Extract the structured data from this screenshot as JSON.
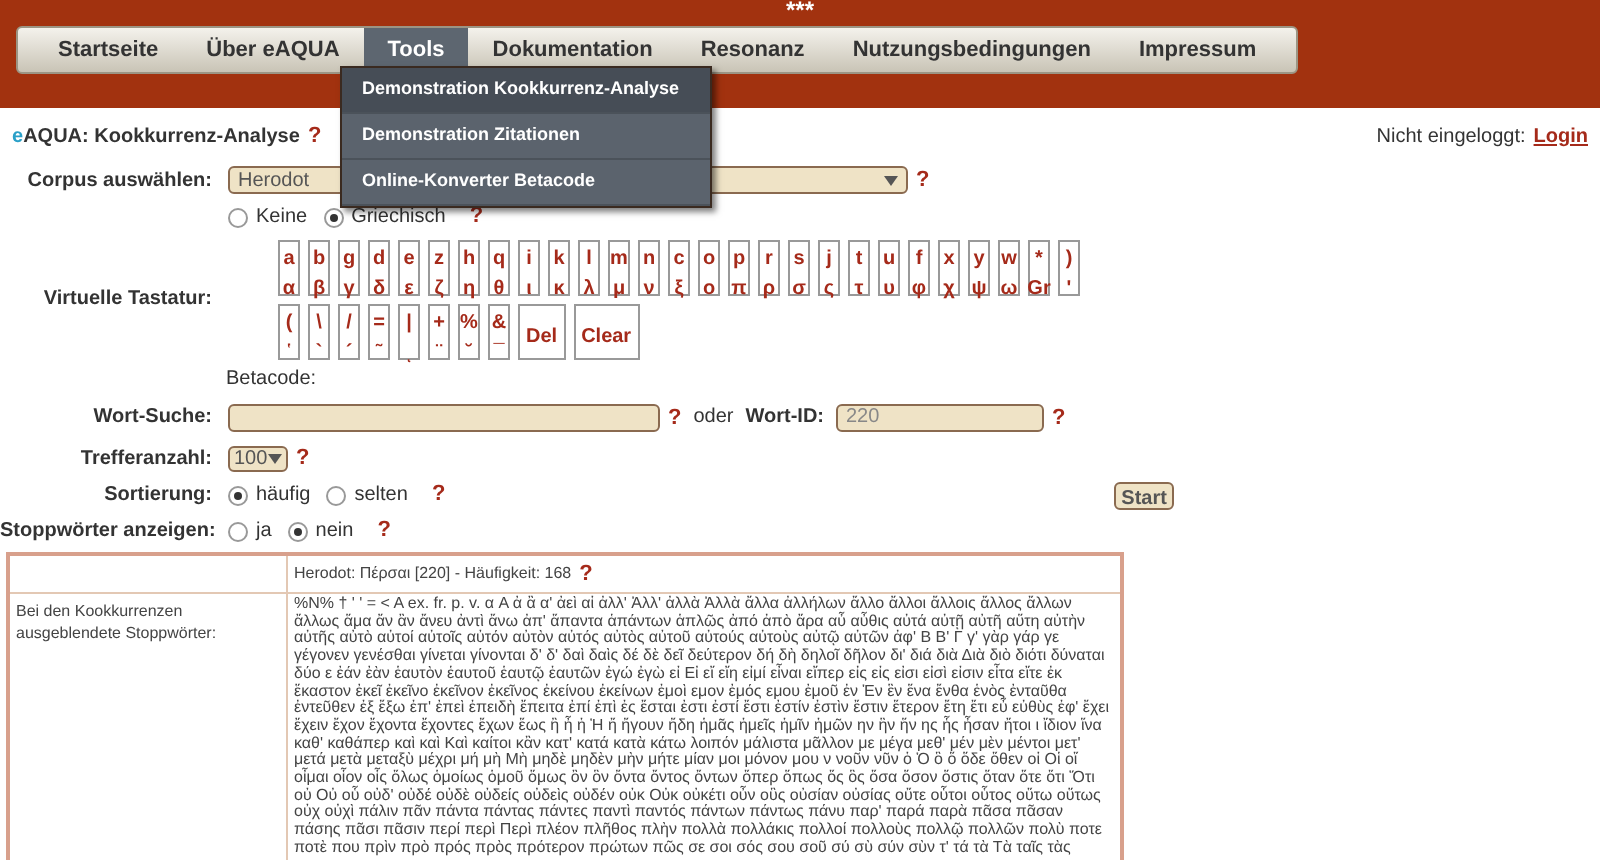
{
  "header": {
    "stars": "***"
  },
  "nav": [
    {
      "label": "Startseite",
      "selected": false
    },
    {
      "label": "Über eAQUA",
      "selected": false
    },
    {
      "label": "Tools",
      "selected": true
    },
    {
      "label": "Dokumentation",
      "selected": false
    },
    {
      "label": "Resonanz",
      "selected": false
    },
    {
      "label": "Nutzungsbedingungen",
      "selected": false
    },
    {
      "label": "Impressum",
      "selected": false
    }
  ],
  "menu": [
    {
      "label": "Demonstration Kookkurrenz-Analyse",
      "selected": true
    },
    {
      "label": "Demonstration Zitationen",
      "selected": false
    },
    {
      "label": "Online-Konverter Betacode",
      "selected": false
    }
  ],
  "title": {
    "logo_e": "e",
    "logo_rest": "AQUA",
    "text": ": Kookkurrenz-Analyse",
    "help": "?"
  },
  "login": {
    "status": "Nicht eingeloggt:",
    "link": "Login"
  },
  "corpus": {
    "label": "Corpus auswählen:",
    "value": "Herodot",
    "help": "?",
    "options": [
      {
        "label": "Keine",
        "selected": false
      },
      {
        "label": "Griechisch",
        "selected": true
      }
    ],
    "options_help": "?"
  },
  "keyboard": {
    "label": "Virtuelle Tastatur:",
    "letter_keys": [
      {
        "top": "a",
        "bottom": "α"
      },
      {
        "top": "b",
        "bottom": "β"
      },
      {
        "top": "g",
        "bottom": "γ"
      },
      {
        "top": "d",
        "bottom": "δ"
      },
      {
        "top": "e",
        "bottom": "ε"
      },
      {
        "top": "z",
        "bottom": "ζ"
      },
      {
        "top": "h",
        "bottom": "η"
      },
      {
        "top": "q",
        "bottom": "θ"
      },
      {
        "top": "i",
        "bottom": "ι"
      },
      {
        "top": "k",
        "bottom": "κ"
      },
      {
        "top": "l",
        "bottom": "λ"
      },
      {
        "top": "m",
        "bottom": "μ"
      },
      {
        "top": "n",
        "bottom": "ν"
      },
      {
        "top": "c",
        "bottom": "ξ"
      },
      {
        "top": "o",
        "bottom": "ο"
      },
      {
        "top": "p",
        "bottom": "π"
      },
      {
        "top": "r",
        "bottom": "ρ"
      },
      {
        "top": "s",
        "bottom": "σ"
      },
      {
        "top": "j",
        "bottom": "ς"
      },
      {
        "top": "t",
        "bottom": "τ"
      },
      {
        "top": "u",
        "bottom": "υ"
      },
      {
        "top": "f",
        "bottom": "φ"
      },
      {
        "top": "x",
        "bottom": "χ"
      },
      {
        "top": "y",
        "bottom": "ψ"
      },
      {
        "top": "w",
        "bottom": "ω"
      },
      {
        "top": "*",
        "bottom": "Gr"
      },
      {
        "top": ")",
        "bottom": "'"
      }
    ],
    "symbol_keys": [
      {
        "top": "(",
        "bottom": "῾"
      },
      {
        "top": "\\",
        "bottom": "`"
      },
      {
        "top": "/",
        "bottom": "´"
      },
      {
        "top": "=",
        "bottom": "῀"
      },
      {
        "top": "|",
        "bottom": "ͺ"
      },
      {
        "top": "+",
        "bottom": "¨"
      },
      {
        "top": "%",
        "bottom": "˘"
      },
      {
        "top": "&",
        "bottom": "¯"
      }
    ],
    "action_keys": [
      "Del",
      "Clear"
    ],
    "betacode_label": "Betacode:"
  },
  "word_search": {
    "label": "Wort-Suche:",
    "help": "?",
    "or": "oder",
    "id_label": "Wort-ID:",
    "id_value": "220",
    "id_help": "?"
  },
  "hits": {
    "label": "Trefferanzahl:",
    "value": "100",
    "help": "?"
  },
  "sorting": {
    "label": "Sortierung:",
    "options": [
      {
        "label": "häufig",
        "selected": true
      },
      {
        "label": "selten",
        "selected": false
      }
    ],
    "help": "?"
  },
  "start_button": "Start",
  "stopwords_toggle": {
    "label": "Stoppwörter anzeigen:",
    "options": [
      {
        "label": "ja",
        "selected": false
      },
      {
        "label": "nein",
        "selected": true
      }
    ],
    "help": "?"
  },
  "result": {
    "header": "Herodot: Πέρσαι [220] - Häufigkeit: 168",
    "header_help": "?",
    "row_label": "Bei den Kookkurrenzen ausgeblendete Stoppwörter:",
    "stopwords": "%N% † ' ' = < A ex. fr. p. v. α A ἀ ἂ α' ἀεὶ αἱ ἀλλ' Ἀλλ' ἀλλὰ Ἀλλὰ ἄλλα ἀλλήλων ἄλλο ἄλλοι ἄλλοις ἄλλος ἄλλων ἄλλως ἅμα ἄν ἂν ἄνευ ἀντὶ ἄνω ἀπ' ἅπαντα ἁπάντων ἁπλῶς ἀπό ἀπὸ ἄρα αὖ αὖθις αὐτά αὐτῇ αὐτῆ αὕτη αὐτὴν αὐτῆς αὐτὸ αὐτοί αὐτοῖς αὐτόν αὐτὸν αὐτός αὐτὸς αὐτοῦ αὐτούς αὐτοὺς αὐτῷ αὐτῶν ἀφ' Β Β' Γ γ' γὰρ γάρ γε γέγονεν γενέσθαι γίνεται γίνονται δ' δ' δαὶ δαὶς δέ δὲ δεῖ δεύτερον δή δὴ δηλοῖ δῆλον δι' διά διὰ Διὰ διὸ διότι δύναται δύο ε ἐάν ἐὰν ἑαυτὸν ἑαυτοῦ ἑαυτῷ ἑαυτῶν ἐγώ ἐγὼ εἰ Εἰ εἴ εἴη εἰμί εἶναι εἴπερ εἰς εἰς εἰσι εἰσὶ εἰσιν εἶτα εἴτε ἐκ ἕκαστον ἐκεῖ ἐκεῖνο ἐκεῖνον ἐκεῖνος ἐκείνου ἐκείνων ἐμοὶ εμον ἐμός εμου ἐμοῦ ἐν Ἐν ἓν ἕνα ἔνθα ἑνὸς ἐνταῦθα ἐντεῦθεν ἐξ ἔξω ἐπ' ἐπεὶ ἐπειδὴ ἔπειτα ἐπί ἐπὶ ἐς ἔσται ἐστι ἐστί ἔστι ἐστίν ἐστὶν ἔστιν ἕτερον ἔτη ἔτι εὖ εὐθὺς ἐφ' ἔχει ἔχειν ἔχον ἔχοντα ἔχοντες ἔχων ἕως ἢ ἦ ἡ Ἡ ἤ ἤγουν ἤδη ἡμᾶς ἡμεῖς ἡμῖν ἡμῶν ην ἣν ἥν ης ἧς ἦσαν ἤτοι ι ἴδιον ἵνα καθ' καθάπερ καὶ καὶ Καὶ καίτοι κἂν κατ' κατά κατὰ κάτω λοιπόν μάλιστα μᾶλλον με μέγα μεθ' μέν μὲν μέντοι μετ' μετά μετὰ μεταξὺ μέχρι μή μὴ Μὴ μηδὲ μηδὲν μὴν μήτε μίαν μοι μόνον μου ν νοῦν νῦν ὁ Ὁ ὃ ὅ ὅδε ὅθεν οἱ Οἱ οἵ οἶμαι οἷον οἷς ὅλως ὁμοίως ὁμοῦ ὅμως ὂν ὃν ὄντα ὄντος ὄντων ὅπερ ὅπως ὅς ὃς ὅσα ὅσον ὅστις ὅταν ὅτε ὅτι Ὅτι οὐ Οὐ οὗ οὐδ' οὐδέ οὐδὲ οὐδείς οὐδεὶς οὐδέν οὐκ Οὐκ οὐκέτι οὖν οὓς οὐσίαν οὐσίας οὔτε οὗτοι οὗτος οὕτω οὕτως οὐχ οὐχὶ πάλιν πᾶν πάντα πάντας πάντες παντὶ παντός πάντων πάντως πάνυ παρ' παρά παρὰ πᾶσα πᾶσαν πάσης πᾶσι πᾶσιν περί περὶ Περὶ πλέον πλῆθος πλὴν πολλὰ πολλάκις πολλοί πολλοὺς πολλῷ πολλῶν πολὺ ποτε ποτὲ που πρὶν πρὸ πρός πρὸς πρότερον πρώτων πῶς σε σοι σός σου σοῦ σύ σὺ σύν σὺν τ' τά τὰ Τὰ ταῖς τὰς"
  }
}
